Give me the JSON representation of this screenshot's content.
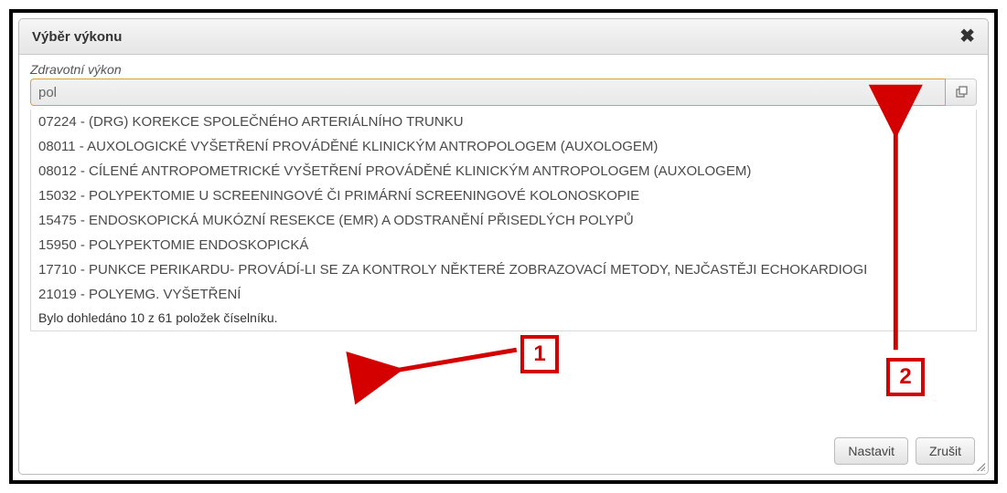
{
  "dialog": {
    "title": "Výběr výkonu",
    "field_label": "Zdravotní výkon",
    "search_value": "pol",
    "dropdown_items": [
      "07224 - (DRG) KOREKCE SPOLEČNÉHO ARTERIÁLNÍHO TRUNKU",
      "08011 - AUXOLOGICKÉ VYŠETŘENÍ PROVÁDĚNÉ KLINICKÝM ANTROPOLOGEM (AUXOLOGEM)",
      "08012 - CÍLENÉ ANTROPOMETRICKÉ VYŠETŘENÍ PROVÁDĚNÉ KLINICKÝM ANTROPOLOGEM (AUXOLOGEM)",
      "15032 - POLYPEKTOMIE U SCREENINGOVÉ ČI PRIMÁRNÍ SCREENINGOVÉ KOLONOSKOPIE",
      "15475 - ENDOSKOPICKÁ MUKÓZNÍ RESEKCE (EMR) A ODSTRANĚNÍ PŘISEDLÝCH POLYPŮ",
      "15950 - POLYPEKTOMIE ENDOSKOPICKÁ",
      "17710 - PUNKCE PERIKARDU- PROVÁDÍ-LI SE ZA KONTROLY NĚKTERÉ ZOBRAZOVACÍ METODY, NEJČASTĚJI ECHOKARDIOGI",
      "21019 - POLYEMG. VYŠETŘENÍ"
    ],
    "status_text": "Bylo dohledáno 10 z 61 položek číselníku.",
    "buttons": {
      "set": "Nastavit",
      "cancel": "Zrušit"
    }
  },
  "annotations": {
    "callout1": "1",
    "callout2": "2"
  }
}
